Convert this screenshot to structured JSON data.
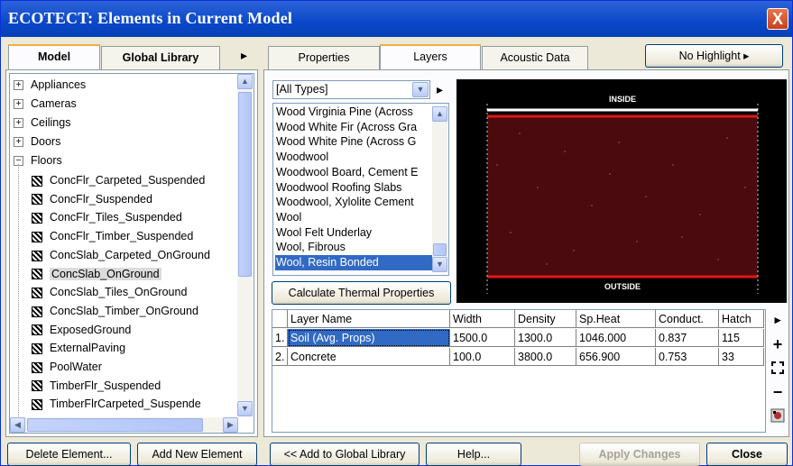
{
  "window": {
    "title": "ECOTECT: Elements in Current Model",
    "close_glyph": "X"
  },
  "left_tabs": {
    "model": "Model",
    "global_library": "Global Library",
    "more_arrow": "▸"
  },
  "tree": {
    "categories": [
      {
        "expander": "+",
        "label": "Appliances"
      },
      {
        "expander": "+",
        "label": "Cameras"
      },
      {
        "expander": "+",
        "label": "Ceilings"
      },
      {
        "expander": "+",
        "label": "Doors"
      },
      {
        "expander": "−",
        "label": "Floors"
      }
    ],
    "items": [
      "ConcFlr_Carpeted_Suspended",
      "ConcFlr_Suspended",
      "ConcFlr_Tiles_Suspended",
      "ConcFlr_Timber_Suspended",
      "ConcSlab_Carpeted_OnGround",
      "ConcSlab_OnGround",
      "ConcSlab_Tiles_OnGround",
      "ConcSlab_Timber_OnGround",
      "ExposedGround",
      "ExternalPaving",
      "PoolWater",
      "TimberFlr_Suspended",
      "TimberFlrCarpeted_Suspende"
    ],
    "selected_item": "ConcSlab_OnGround"
  },
  "bottom_left_buttons": {
    "delete": "Delete Element...",
    "add": "Add New Element"
  },
  "right_tabs": {
    "properties": "Properties",
    "layers": "Layers",
    "acoustic": "Acoustic Data",
    "highlight": "No Highlight ▸"
  },
  "type_filter": {
    "value": "[All Types]",
    "next_arrow": "▸"
  },
  "materials": [
    "Wood Virginia Pine (Across",
    "Wood White Fir (Across Gra",
    "Wood White Pine (Across G",
    "Woodwool",
    "Woodwool Board, Cement E",
    "Woodwool Roofing Slabs",
    "Woodwool, Xylolite Cement",
    "Wool",
    "Wool Felt Underlay",
    "Wool, Fibrous",
    "Wool, Resin Bonded"
  ],
  "selected_material": "Wool, Resin Bonded",
  "calc_button": "Calculate Thermal Properties",
  "preview": {
    "top_label": "INSIDE",
    "bottom_label": "OUTSIDE",
    "background": "#000000",
    "layer_fill": "#4a0a0e",
    "boundary_color": "#e01818"
  },
  "layers_table": {
    "headers": [
      "",
      "Layer Name",
      "Width",
      "Density",
      "Sp.Heat",
      "Conduct.",
      "Hatch"
    ],
    "rows": [
      [
        "1.",
        "Soil (Avg. Props)",
        "1500.0",
        "1300.0",
        "1046.000",
        "0.837",
        "115"
      ],
      [
        "2.",
        "Concrete",
        "100.0",
        "3800.0",
        "656.900",
        "0.753",
        "33"
      ]
    ]
  },
  "side_controls": {
    "arrow": "▸",
    "add": "+",
    "minus": "−"
  },
  "bottom_right_buttons": {
    "add_global": "<< Add to Global Library",
    "help": "Help...",
    "apply": "Apply Changes",
    "close": "Close"
  }
}
